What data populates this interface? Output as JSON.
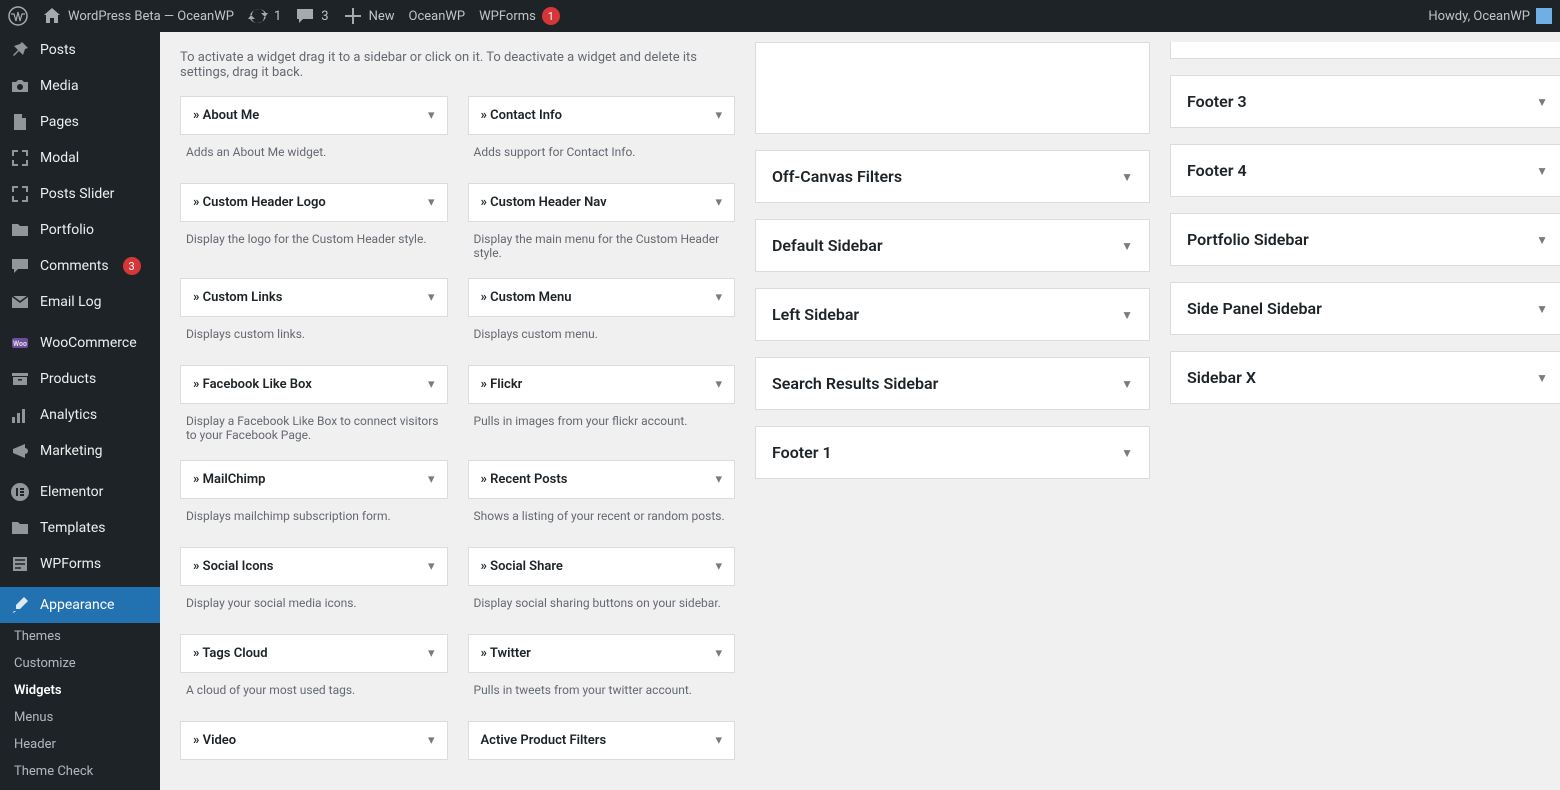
{
  "adminbar": {
    "site_title": "WordPress Beta — OceanWP",
    "updates": "1",
    "comments": "3",
    "new": "New",
    "items": [
      "OceanWP",
      "WPForms"
    ],
    "wpforms_badge": "1",
    "howdy": "Howdy, OceanWP"
  },
  "menu": {
    "items": [
      {
        "label": "Posts",
        "icon": "pin"
      },
      {
        "label": "Media",
        "icon": "camera"
      },
      {
        "label": "Pages",
        "icon": "page"
      },
      {
        "label": "Modal",
        "icon": "expand"
      },
      {
        "label": "Posts Slider",
        "icon": "expand"
      },
      {
        "label": "Portfolio",
        "icon": "folder"
      },
      {
        "label": "Comments",
        "icon": "comment",
        "badge": "3"
      },
      {
        "label": "Email Log",
        "icon": "mail"
      },
      {
        "label": "WooCommerce",
        "icon": "woo"
      },
      {
        "label": "Products",
        "icon": "archive"
      },
      {
        "label": "Analytics",
        "icon": "stats"
      },
      {
        "label": "Marketing",
        "icon": "mega"
      },
      {
        "label": "Elementor",
        "icon": "e"
      },
      {
        "label": "Templates",
        "icon": "folder"
      },
      {
        "label": "WPForms",
        "icon": "wpf"
      },
      {
        "label": "Appearance",
        "icon": "brush",
        "current": true
      }
    ],
    "appearance_sub": [
      {
        "label": "Themes"
      },
      {
        "label": "Customize"
      },
      {
        "label": "Widgets",
        "current": true
      },
      {
        "label": "Menus"
      },
      {
        "label": "Header"
      },
      {
        "label": "Theme Check"
      }
    ]
  },
  "content": {
    "helptext": "To activate a widget drag it to a sidebar or click on it. To deactivate a widget and delete its settings, drag it back.",
    "available": [
      {
        "title": "» About Me",
        "desc": "Adds an About Me widget."
      },
      {
        "title": "» Contact Info",
        "desc": "Adds support for Contact Info."
      },
      {
        "title": "» Custom Header Logo",
        "desc": "Display the logo for the Custom Header style."
      },
      {
        "title": "» Custom Header Nav",
        "desc": "Display the main menu for the Custom Header style."
      },
      {
        "title": "» Custom Links",
        "desc": "Displays custom links."
      },
      {
        "title": "» Custom Menu",
        "desc": "Displays custom menu."
      },
      {
        "title": "» Facebook Like Box",
        "desc": "Display a Facebook Like Box to connect visitors to your Facebook Page."
      },
      {
        "title": "» Flickr",
        "desc": "Pulls in images from your flickr account."
      },
      {
        "title": "» MailChimp",
        "desc": "Displays mailchimp subscription form."
      },
      {
        "title": "» Recent Posts",
        "desc": "Shows a listing of your recent or random posts."
      },
      {
        "title": "» Social Icons",
        "desc": "Display your social media icons."
      },
      {
        "title": "» Social Share",
        "desc": "Display social sharing buttons on your sidebar."
      },
      {
        "title": "» Tags Cloud",
        "desc": "A cloud of your most used tags."
      },
      {
        "title": "» Twitter",
        "desc": "Pulls in tweets from your twitter account."
      },
      {
        "title": "» Video",
        "desc": ""
      },
      {
        "title": "Active Product Filters",
        "desc": ""
      }
    ],
    "areas_mid": [
      {
        "name": "",
        "open": true
      },
      {
        "name": "Off-Canvas Filters"
      },
      {
        "name": "Default Sidebar"
      },
      {
        "name": "Left Sidebar"
      },
      {
        "name": "Search Results Sidebar"
      },
      {
        "name": "Footer 1"
      }
    ],
    "areas_right": [
      {
        "name": "",
        "cut": true
      },
      {
        "name": "Footer 3"
      },
      {
        "name": "Footer 4"
      },
      {
        "name": "Portfolio Sidebar"
      },
      {
        "name": "Side Panel Sidebar"
      },
      {
        "name": "Sidebar X"
      }
    ]
  }
}
